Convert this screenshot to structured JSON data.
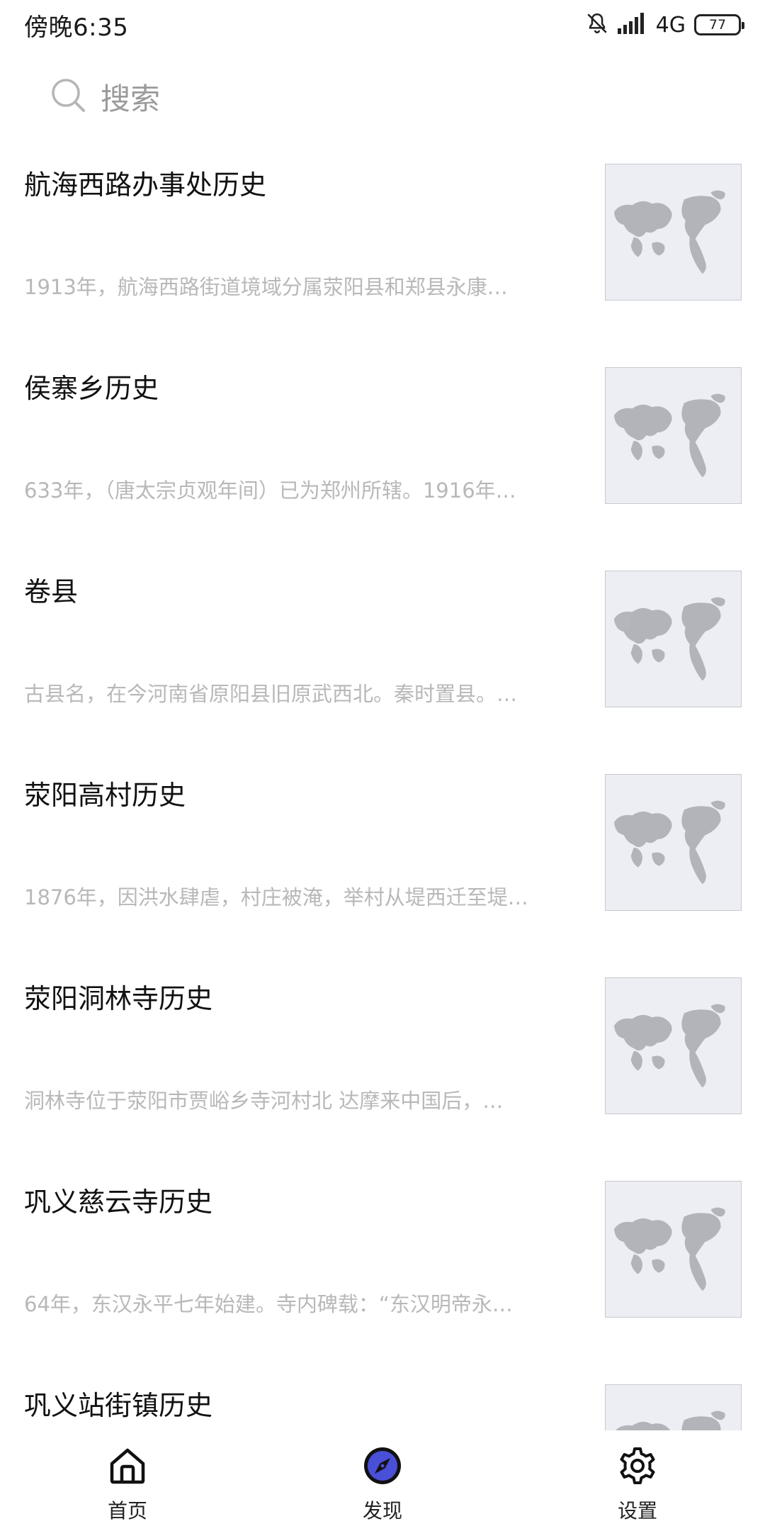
{
  "status_bar": {
    "time": "傍晚6:35",
    "network": "4G",
    "battery": "77"
  },
  "search": {
    "placeholder": "搜索"
  },
  "list": [
    {
      "title": "航海西路办事处历史",
      "summary": "1913年，航海西路街道境域分属荥阳县和郑县永康…"
    },
    {
      "title": "侯寨乡历史",
      "summary": "633年，（唐太宗贞观年间）已为郑州所辖。1916年…"
    },
    {
      "title": "卷县",
      "summary": "古县名，在今河南省原阳县旧原武西北。秦时置县。…"
    },
    {
      "title": "荥阳高村历史",
      "summary": "1876年，因洪水肆虐，村庄被淹，举村从堤西迁至堤…"
    },
    {
      "title": "荥阳洞林寺历史",
      "summary": "洞林寺位于荥阳市贾峪乡寺河村北 达摩来中国后，…"
    },
    {
      "title": "巩义慈云寺历史",
      "summary": "64年，东汉永平七年始建。寺内碑载：“东汉明帝永…"
    },
    {
      "title": "巩义站街镇历史",
      "summary": ""
    }
  ],
  "bottom_nav": {
    "home_label": "首页",
    "discover_label": "发现",
    "settings_label": "设置"
  },
  "colors": {
    "discover_accent": "#4a4fd8",
    "summary_gray": "#b8b8b8",
    "thumb_bg": "#eceef4"
  }
}
